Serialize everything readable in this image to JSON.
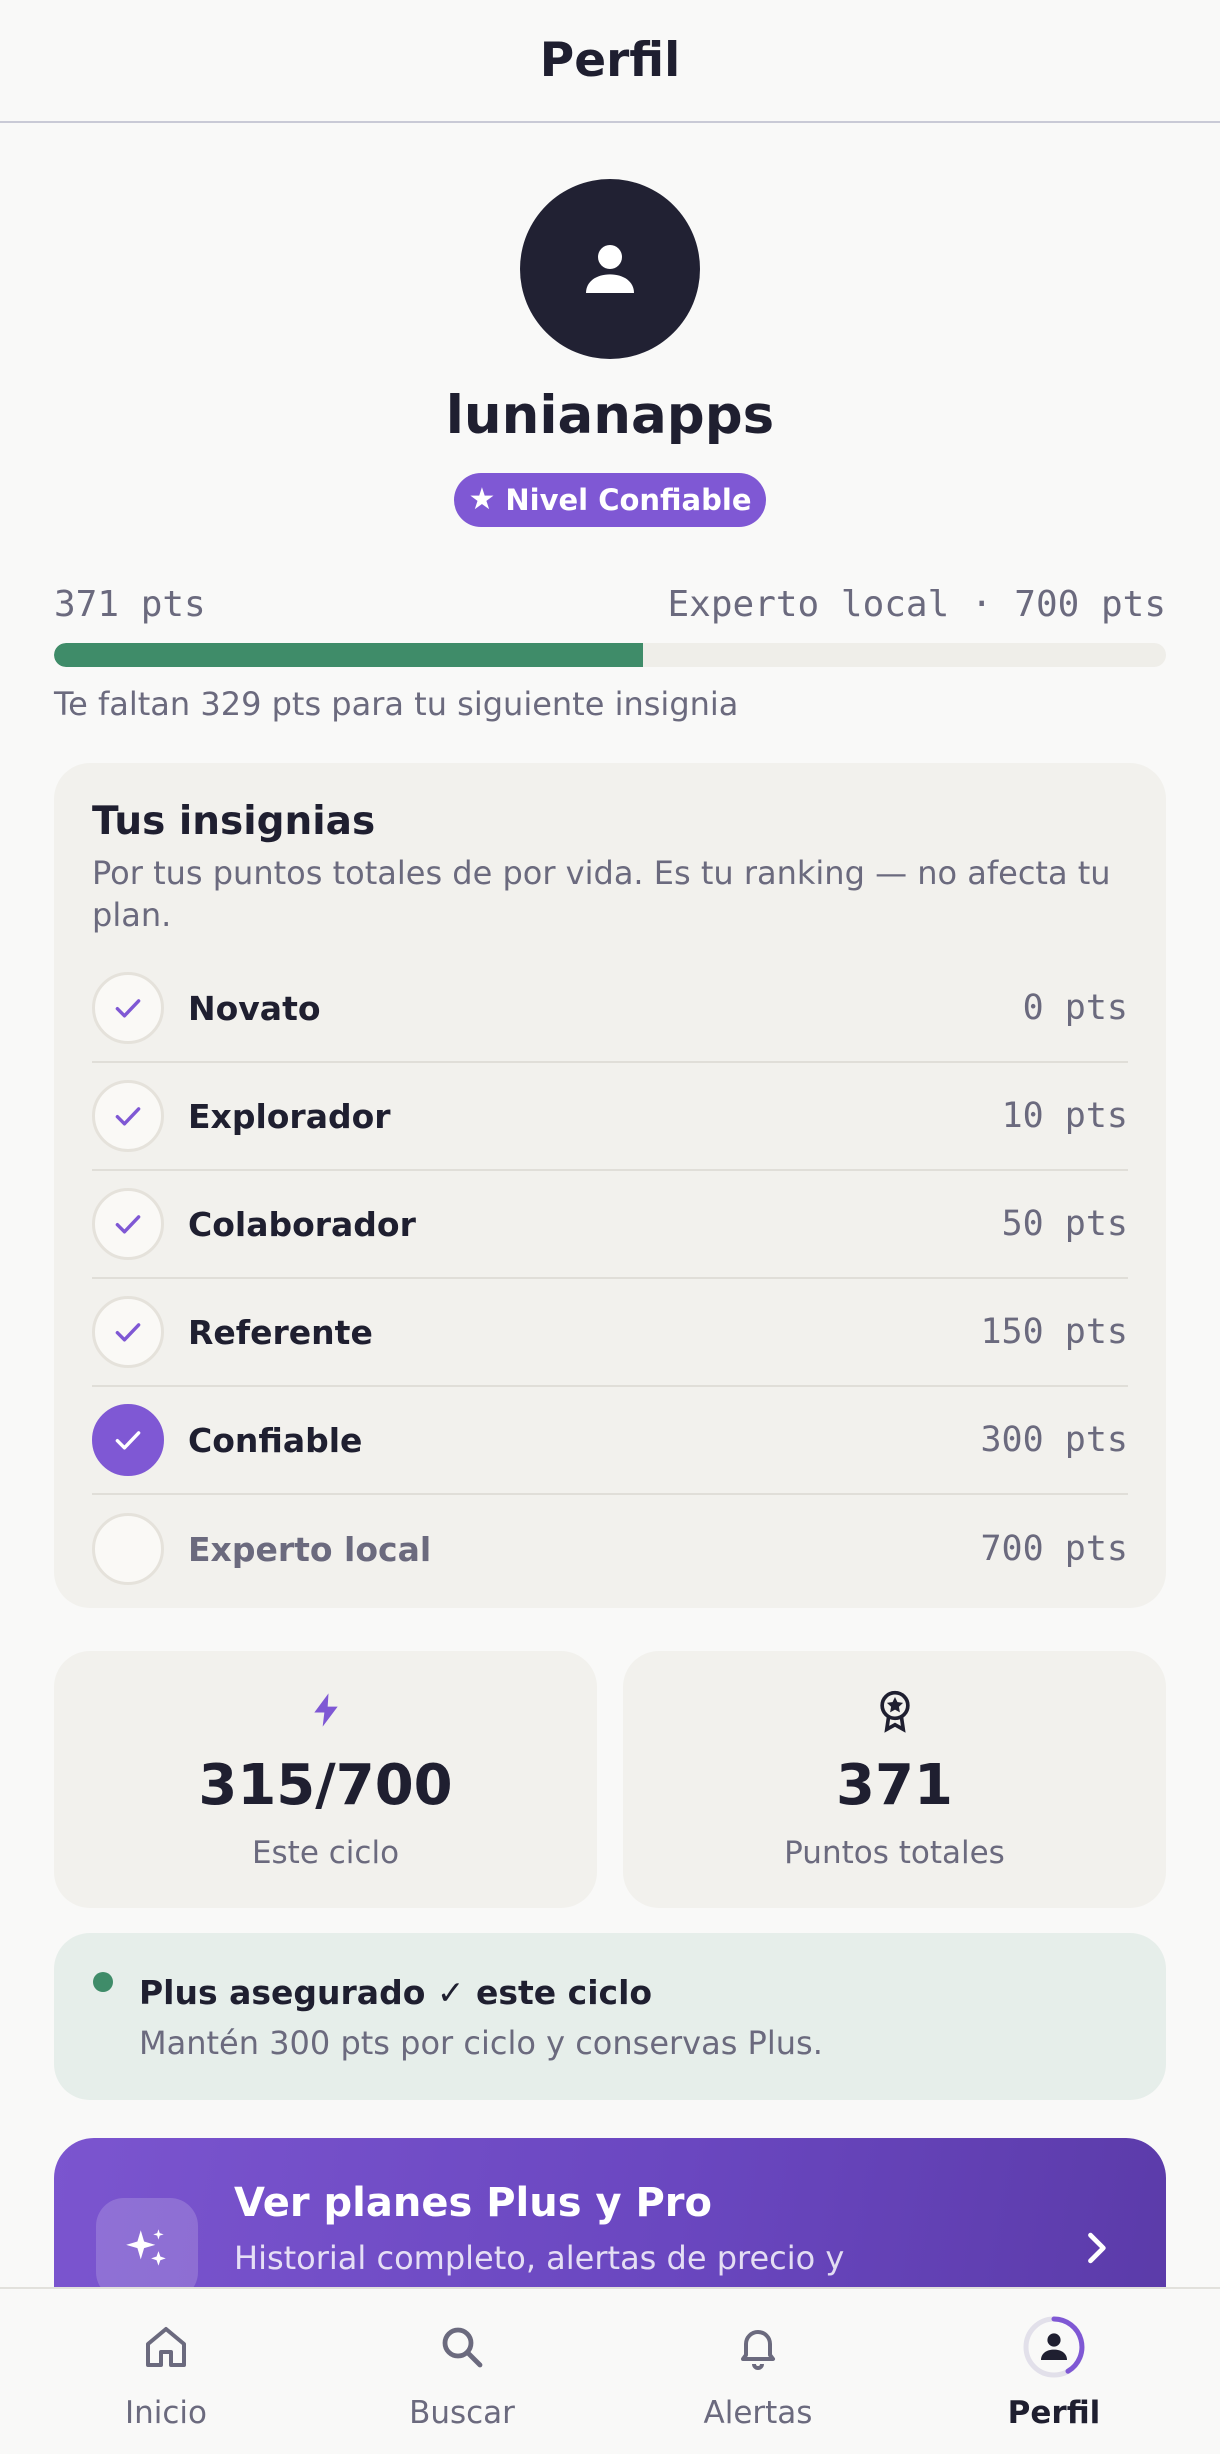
{
  "header": {
    "title": "Perfil"
  },
  "profile": {
    "avatar_icon": "user-icon",
    "username": "lunianapps",
    "level_badge": "Nivel Confiable"
  },
  "progress": {
    "current": "371 pts",
    "next": "Experto local · 700 pts",
    "fraction": 0.53,
    "missing_text": "Te faltan 329 pts para tu siguiente insignia"
  },
  "badges": {
    "title": "Tus insignias",
    "subtitle": "Por tus puntos totales de por vida. Es tu ranking — no afecta tu plan.",
    "items": [
      {
        "name": "Novato",
        "pts": "0 pts",
        "state": "earned"
      },
      {
        "name": "Explorador",
        "pts": "10 pts",
        "state": "earned"
      },
      {
        "name": "Colaborador",
        "pts": "50 pts",
        "state": "earned"
      },
      {
        "name": "Referente",
        "pts": "150 pts",
        "state": "earned"
      },
      {
        "name": "Confiable",
        "pts": "300 pts",
        "state": "current"
      },
      {
        "name": "Experto local",
        "pts": "700 pts",
        "state": "locked"
      }
    ]
  },
  "stats": {
    "cycle": {
      "value": "315/700",
      "label": "Este ciclo",
      "icon": "bolt-icon"
    },
    "total": {
      "value": "371",
      "label": "Puntos totales",
      "icon": "award-icon"
    }
  },
  "plus_status": {
    "title": "Plus asegurado ✓ este ciclo",
    "description": "Mantén 300 pts por ciclo y conservas Plus."
  },
  "promo": {
    "title": "Ver planes Plus y Pro",
    "description": "Historial completo, alertas de precio y",
    "icon": "sparkles-icon"
  },
  "tabs": [
    {
      "label": "Inicio",
      "icon": "home-icon"
    },
    {
      "label": "Buscar",
      "icon": "search-icon"
    },
    {
      "label": "Alertas",
      "icon": "bell-icon"
    },
    {
      "label": "Perfil",
      "icon": "profile-icon",
      "active": true
    }
  ],
  "colors": {
    "accent": "#7f58d4",
    "success": "#3f8c69",
    "text": "#1f1f30",
    "muted": "#6b6a7e"
  }
}
